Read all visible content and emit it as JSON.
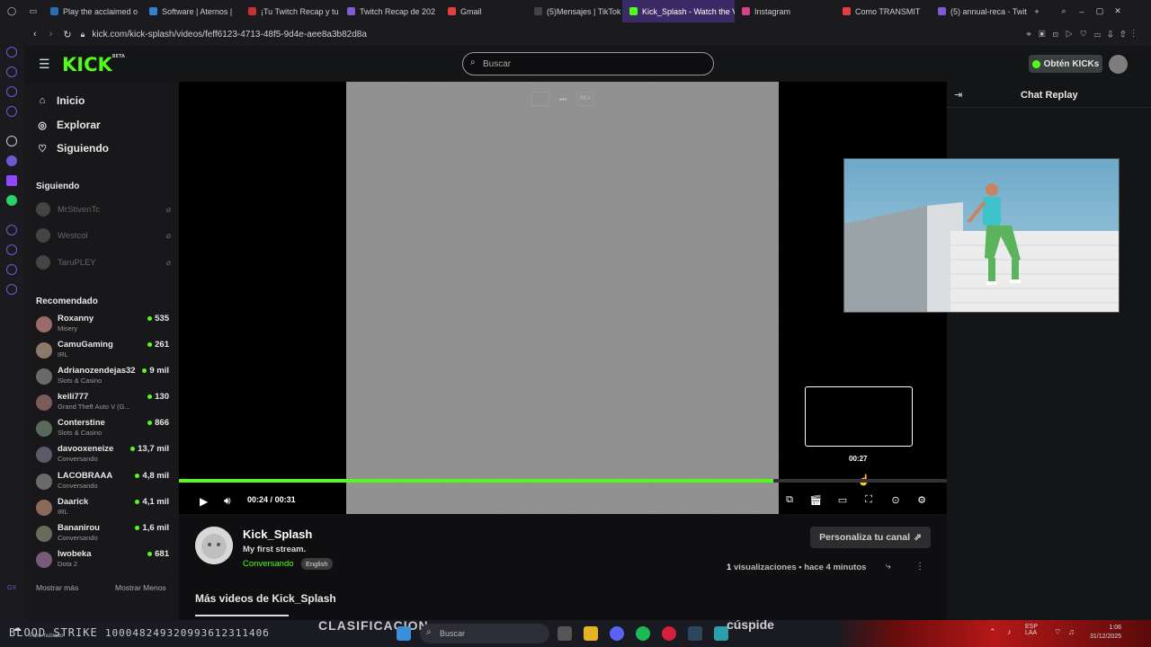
{
  "browser": {
    "tabs": [
      {
        "label": "Play the acclaimed o",
        "color": "#2b6cb0"
      },
      {
        "label": "Software | Aternos |",
        "color": "#3182ce"
      },
      {
        "label": "¡Tu Twitch Recap y tu",
        "color": "#c53030"
      },
      {
        "label": "Twitch Recap de 202",
        "color": "#805ad5"
      },
      {
        "label": "Gmail",
        "color": "#e53e3e"
      },
      {
        "label": "(5)Mensajes | TikTok",
        "color": "#222222"
      },
      {
        "label": "Kick_Splash - Watch the V",
        "color": "#53fc18"
      },
      {
        "label": "Instagram",
        "color": "#d53f8c"
      },
      {
        "label": "Como TRANSMIT",
        "color": "#e53e3e"
      },
      {
        "label": "(5) annual-reca - Twit",
        "color": "#805ad5"
      }
    ],
    "url": "kick.com/kick-splash/videos/feff6123-4713-48f5-9d4e-aee8a3b82d8a",
    "new_tab_icon": "+"
  },
  "header": {
    "logo": "KICK",
    "logo_badge": "BETA",
    "search_placeholder": "Buscar",
    "kicks_button": "Obtén KICKs"
  },
  "sidebar": {
    "nav": [
      {
        "label": "Inicio",
        "icon": "home-icon"
      },
      {
        "label": "Explorar",
        "icon": "compass-icon"
      },
      {
        "label": "Siguiendo",
        "icon": "heart-icon"
      }
    ],
    "following_title": "Siguiendo",
    "following": [
      {
        "name": "MrStivenTc"
      },
      {
        "name": "Westcol"
      },
      {
        "name": "TaruPLEY"
      }
    ],
    "recommended_title": "Recomendado",
    "recommended": [
      {
        "name": "Roxanny",
        "category": "Misery",
        "viewers": "535",
        "color": "#9b6b6b"
      },
      {
        "name": "CamuGaming",
        "category": "IRL",
        "viewers": "261",
        "color": "#8a7a6a"
      },
      {
        "name": "Adrianozendejas32",
        "category": "Slots & Casino",
        "viewers": "9 mil",
        "color": "#6a6a6a"
      },
      {
        "name": "keili777",
        "category": "Grand Theft Auto V (G...",
        "viewers": "130",
        "color": "#7a5a5a"
      },
      {
        "name": "Conterstine",
        "category": "Slots & Casino",
        "viewers": "866",
        "color": "#5a6a5a"
      },
      {
        "name": "davooxeneize",
        "category": "Conversando",
        "viewers": "13,7 mil",
        "color": "#5a5a6a"
      },
      {
        "name": "LACOBRAAA",
        "category": "Conversando",
        "viewers": "4,8 mil",
        "color": "#6a6a6a"
      },
      {
        "name": "Daarick",
        "category": "IRL",
        "viewers": "4,1 mil",
        "color": "#8a6a5a"
      },
      {
        "name": "Bananirou",
        "category": "Conversando",
        "viewers": "1,6 mil",
        "color": "#6a6a5a"
      },
      {
        "name": "lwobeka",
        "category": "Dota 2",
        "viewers": "681",
        "color": "#7a5a7a"
      }
    ],
    "show_more": "Mostrar más",
    "show_less": "Mostrar Menos"
  },
  "player": {
    "top_controls": [
      "",
      "",
      "REX"
    ],
    "current_time": "00:24",
    "separator": "/",
    "duration": "00:31",
    "hover_time": "00:27",
    "progress": 0.7742
  },
  "chat": {
    "title": "Chat Replay"
  },
  "video_info": {
    "channel": "Kick_Splash",
    "title": "My first stream.",
    "category": "Conversando",
    "language": "English",
    "customize_button": "Personaliza tu canal",
    "views_count": "1",
    "views_label": "visualizaciones",
    "time_ago": "hace 4 minutos",
    "more_videos": "Más videos de Kick_Splash"
  },
  "taskbar": {
    "game_name": "BLOOD STRIKE",
    "game_id": "10004824932099361231140б",
    "game_status": "Parc. nublado",
    "overlay_word_1": "CLASIFICACION",
    "search_placeholder": "Buscar",
    "overlay_word_2": "cúspide",
    "tray_lang_1": "ESP",
    "tray_lang_2": "LAA",
    "clock_time": "1:06",
    "clock_date": "31/12/2025"
  }
}
